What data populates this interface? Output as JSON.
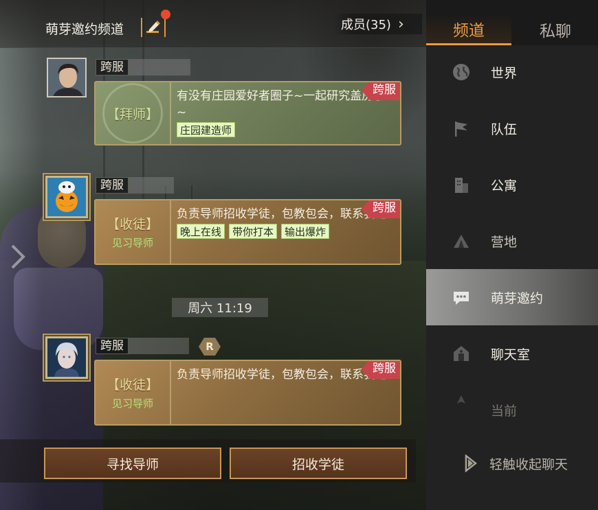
{
  "header": {
    "channel_title": "萌芽邀约频道",
    "members_label": "成员(35)"
  },
  "messages": [
    {
      "cross_server_tag": "跨服",
      "ribbon": "跨服",
      "role": "【拜师】",
      "subrole": "",
      "text": "有没有庄园爱好者圈子~一起研究盖房子~",
      "chips": [
        "庄园建造师"
      ]
    },
    {
      "cross_server_tag": "跨服",
      "ribbon": "跨服",
      "role": "【收徒】",
      "subrole": "见习导师",
      "text": "负责导师招收学徒，包教包会，联系我吧!",
      "chips": [
        "晚上在线",
        "带你打本",
        "输出爆炸"
      ]
    },
    {
      "cross_server_tag": "跨服",
      "ribbon": "跨服",
      "role": "【收徒】",
      "subrole": "见习导师",
      "text": "负责导师招收学徒，包教包会，联系我吧!",
      "chips": [],
      "badge": "R"
    }
  ],
  "timestamp": "周六 11:19",
  "buttons": {
    "find_mentor": "寻找导师",
    "recruit_apprentice": "招收学徒"
  },
  "right_panel": {
    "tabs": [
      "频道",
      "私聊"
    ],
    "active_tab": "频道",
    "nav_items": [
      {
        "label": "世界",
        "icon": "globe-icon"
      },
      {
        "label": "队伍",
        "icon": "flag-icon"
      },
      {
        "label": "公寓",
        "icon": "building-icon"
      },
      {
        "label": "营地",
        "icon": "tent-icon"
      },
      {
        "label": "萌芽邀约",
        "icon": "chat-bubble-icon",
        "active": true
      },
      {
        "label": "聊天室",
        "icon": "house-icon"
      },
      {
        "label": "当前",
        "icon": "location-icon"
      }
    ],
    "collapse_label": "轻触收起聊天"
  },
  "colors": {
    "accent": "#e99b47",
    "ribbon": "#c8434c",
    "chip_bg": "#e7f7c3",
    "button_border": "#c99758"
  }
}
